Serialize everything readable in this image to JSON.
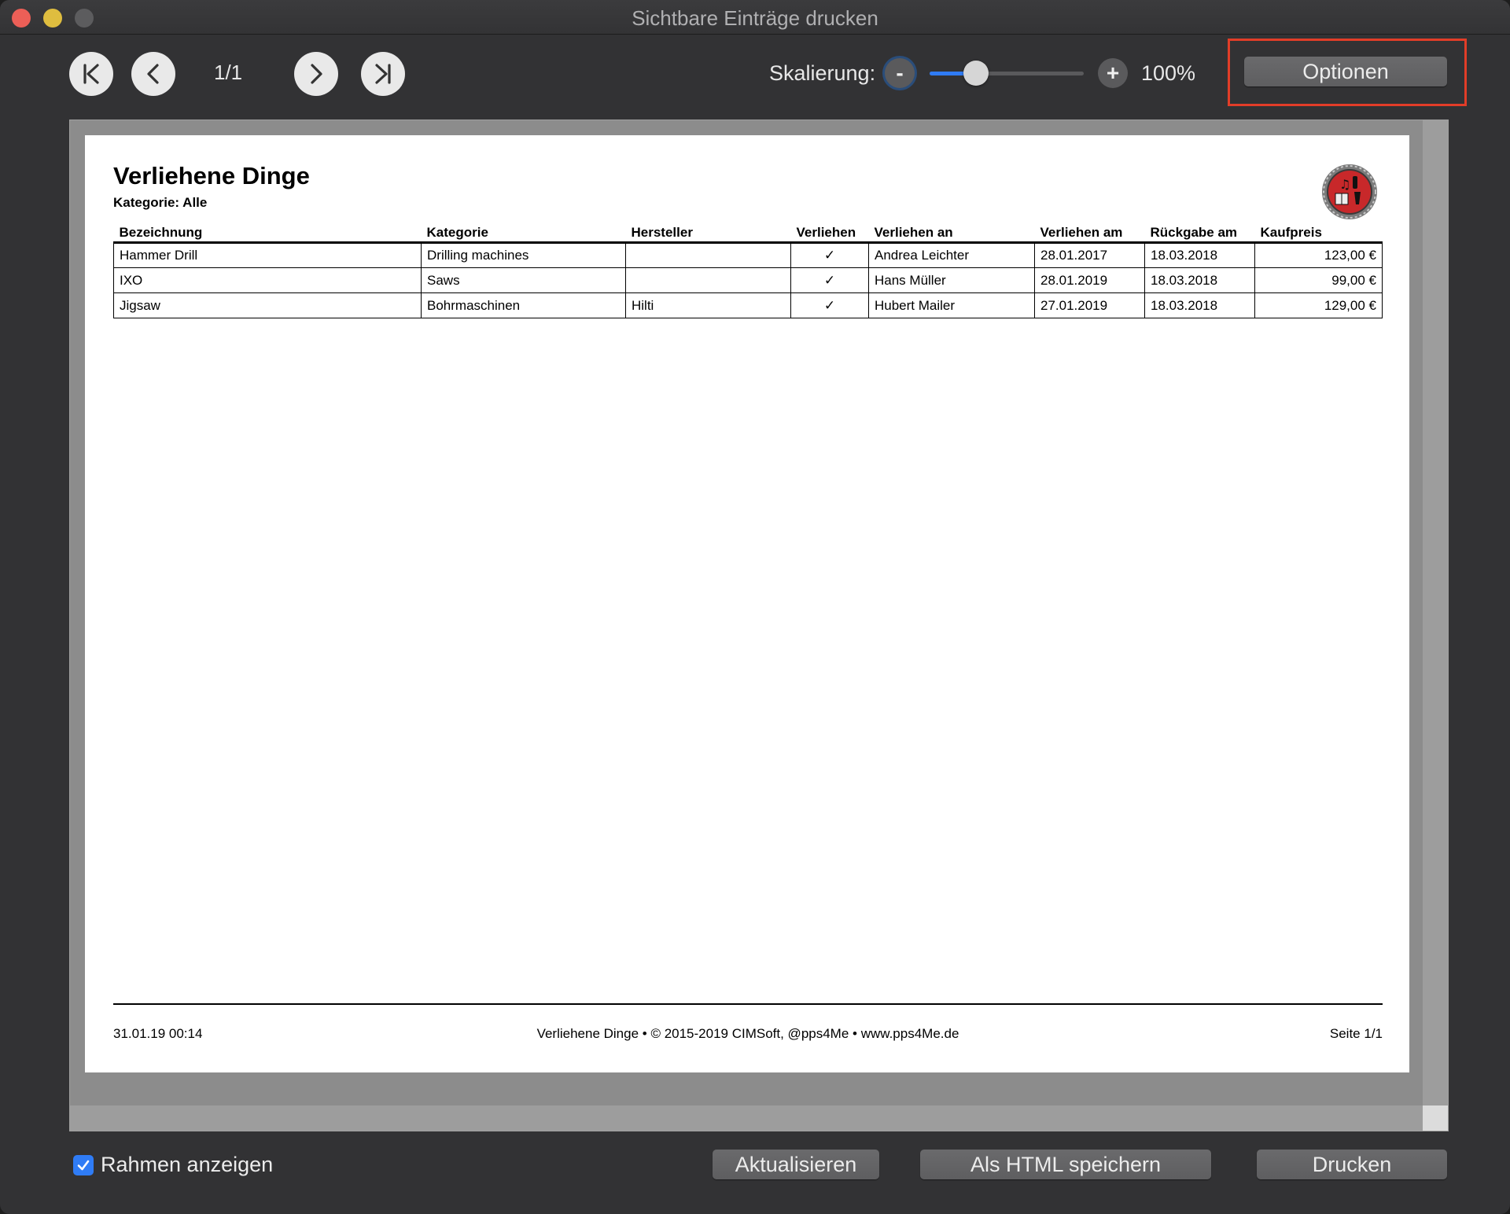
{
  "window": {
    "title": "Sichtbare Einträge drucken"
  },
  "toolbar": {
    "page_indicator": "1/1",
    "scale_label": "Skalierung:",
    "zoom_minus": "-",
    "zoom_plus": "+",
    "zoom_value": "100%",
    "zoom_slider_fraction": 0.3,
    "options_label": "Optionen",
    "icons": [
      "first-page-icon",
      "previous-page-icon",
      "next-page-icon",
      "last-page-icon"
    ]
  },
  "document": {
    "title": "Verliehene Dinge",
    "subtitle": "Kategorie: Alle",
    "columns": [
      "Bezeichnung",
      "Kategorie",
      "Hersteller",
      "Verliehen",
      "Verliehen an",
      "Verliehen am",
      "Rückgabe am",
      "Kaufpreis"
    ],
    "rows": [
      [
        "Hammer Drill",
        "Drilling machines",
        "",
        "✓",
        "Andrea Leichter",
        "28.01.2017",
        "18.03.2018",
        "123,00 €"
      ],
      [
        "IXO",
        "Saws",
        "",
        "✓",
        "Hans Müller",
        "28.01.2019",
        "18.03.2018",
        "99,00 €"
      ],
      [
        "Jigsaw",
        "Bohrmaschinen",
        "Hilti",
        "✓",
        "Hubert Mailer",
        "27.01.2019",
        "18.03.2018",
        "129,00 €"
      ]
    ],
    "footer": {
      "left": "31.01.19 00:14",
      "center": "Verliehene Dinge  •  © 2015-2019 CIMSoft, @pps4Me  •  www.pps4Me.de",
      "right": "Seite 1/1"
    }
  },
  "bottom_bar": {
    "checkbox_label": "Rahmen anzeigen",
    "checkbox_checked": true,
    "update_label": "Aktualisieren",
    "save_html_label": "Als HTML speichern",
    "print_label": "Drucken"
  },
  "colors": {
    "accent": "#2f7cf6",
    "highlight": "#e23d28"
  }
}
